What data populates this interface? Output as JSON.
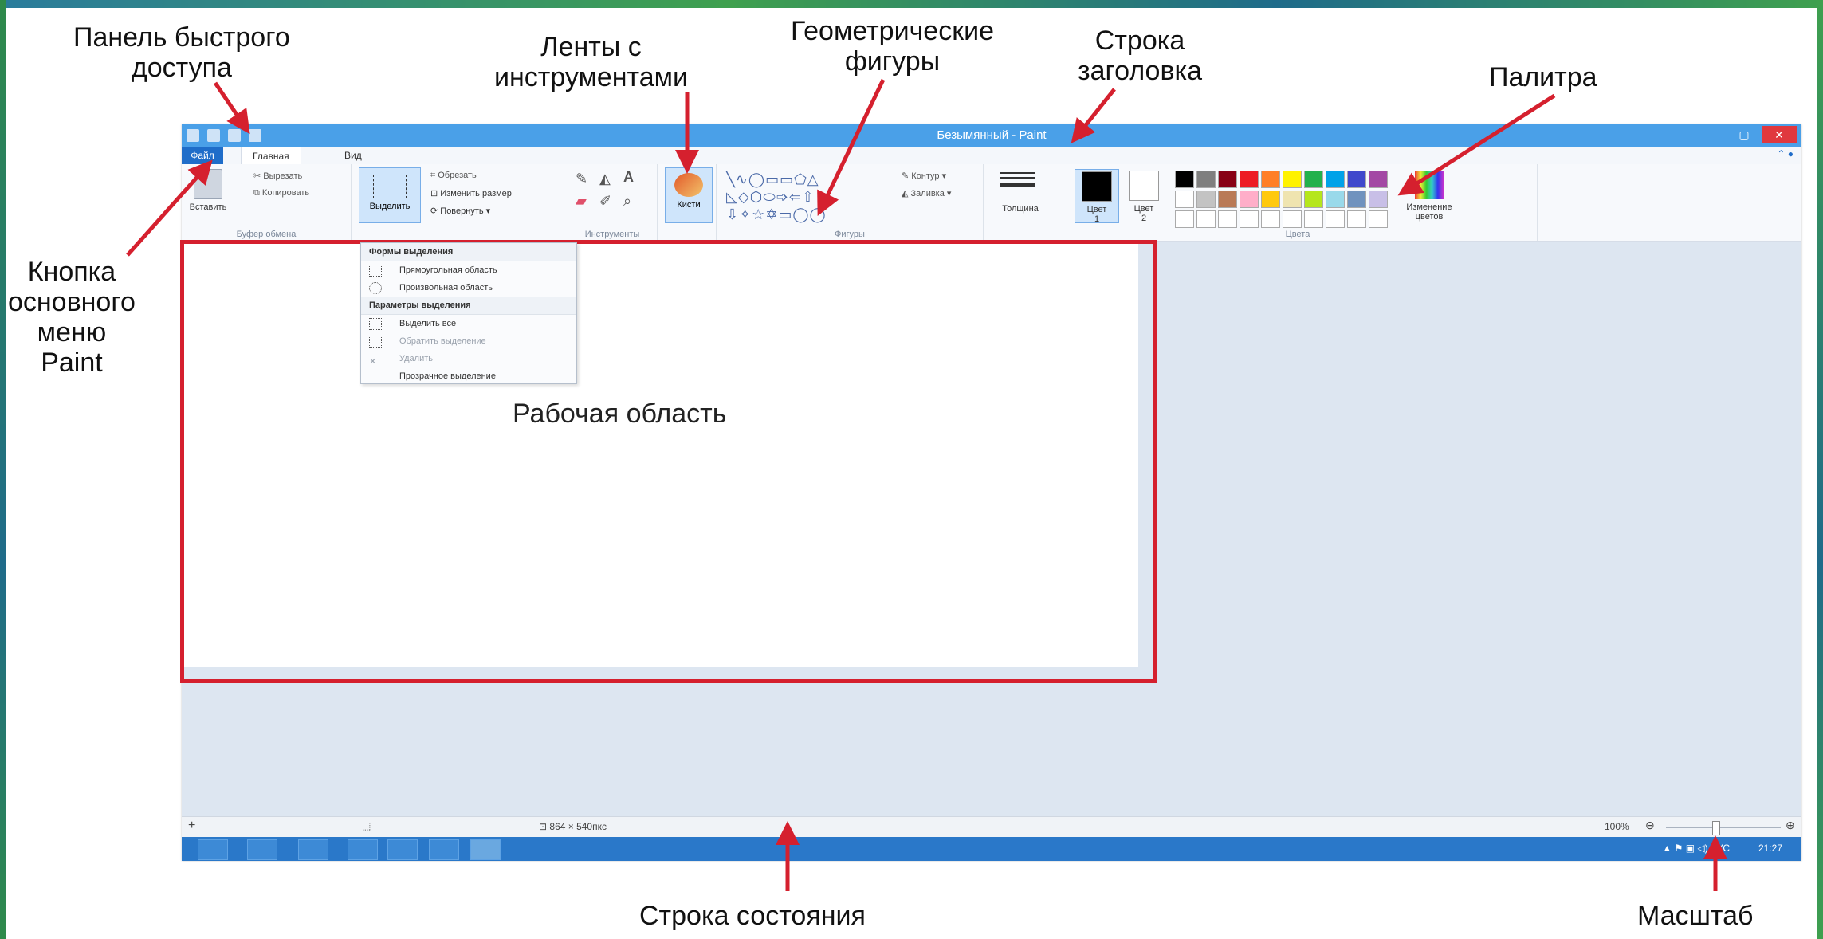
{
  "callouts": {
    "quick_access_line1": "Панель быстрого",
    "quick_access_line2": "доступа",
    "ribbons_line1": "Ленты с",
    "ribbons_line2": "инструментами",
    "shapes_line1": "Геометрические",
    "shapes_line2": "фигуры",
    "titlebar_line1": "Строка",
    "titlebar_line2": "заголовка",
    "palette": "Палитра",
    "menu_btn_line1": "Кнопка",
    "menu_btn_line2": "основного",
    "menu_btn_line3": "меню",
    "menu_btn_line4": "Paint",
    "workarea": "Рабочая область",
    "statusbar": "Строка состояния",
    "zoom": "Масштаб"
  },
  "window": {
    "title": "Безымянный - Paint",
    "minimize": "–",
    "maximize": "▢",
    "close": "✕"
  },
  "tabs": {
    "file": "Файл",
    "home": "Главная",
    "view": "Вид",
    "help_icon": "help-icon"
  },
  "ribbon": {
    "clipboard": {
      "paste": "Вставить",
      "cut": "Вырезать",
      "copy": "Копировать",
      "label": "Буфер обмена"
    },
    "image": {
      "select": "Выделить",
      "crop": "Обрезать",
      "resize": "Изменить размер",
      "rotate": "Повернуть"
    },
    "tools": {
      "label": "Инструменты"
    },
    "brushes": "Кисти",
    "shapes": {
      "outline": "Контур",
      "fill": "Заливка",
      "label": "Фигуры"
    },
    "thickness": "Толщина",
    "colors": {
      "color1": "Цвет",
      "color1_num": "1",
      "color2": "Цвет",
      "color2_num": "2",
      "edit_line1": "Изменение",
      "edit_line2": "цветов",
      "label": "Цвета",
      "palette_row1": [
        "#000000",
        "#7f7f7f",
        "#880015",
        "#ed1c24",
        "#ff7f27",
        "#fff200",
        "#22b14c",
        "#00a2e8",
        "#3f48cc",
        "#a349a4"
      ],
      "palette_row2": [
        "#ffffff",
        "#c3c3c3",
        "#b97a57",
        "#ffaec9",
        "#ffc90e",
        "#efe4b0",
        "#b5e61d",
        "#99d9ea",
        "#7092be",
        "#c8bfe7"
      ]
    }
  },
  "select_menu": {
    "shapes_header": "Формы выделения",
    "rect": "Прямоугольная область",
    "freeform": "Произвольная область",
    "options_header": "Параметры выделения",
    "select_all": "Выделить все",
    "invert": "Обратить выделение",
    "delete": "Удалить",
    "transparent": "Прозрачное выделение"
  },
  "status": {
    "size": "864 × 540пкс",
    "zoom": "100%"
  },
  "taskbar": {
    "lang": "РУС",
    "time": "21:27"
  },
  "colors": {
    "arrow": "#d5202e",
    "titlebar": "#4aa0e8",
    "file_tab": "#1f6dc9"
  }
}
